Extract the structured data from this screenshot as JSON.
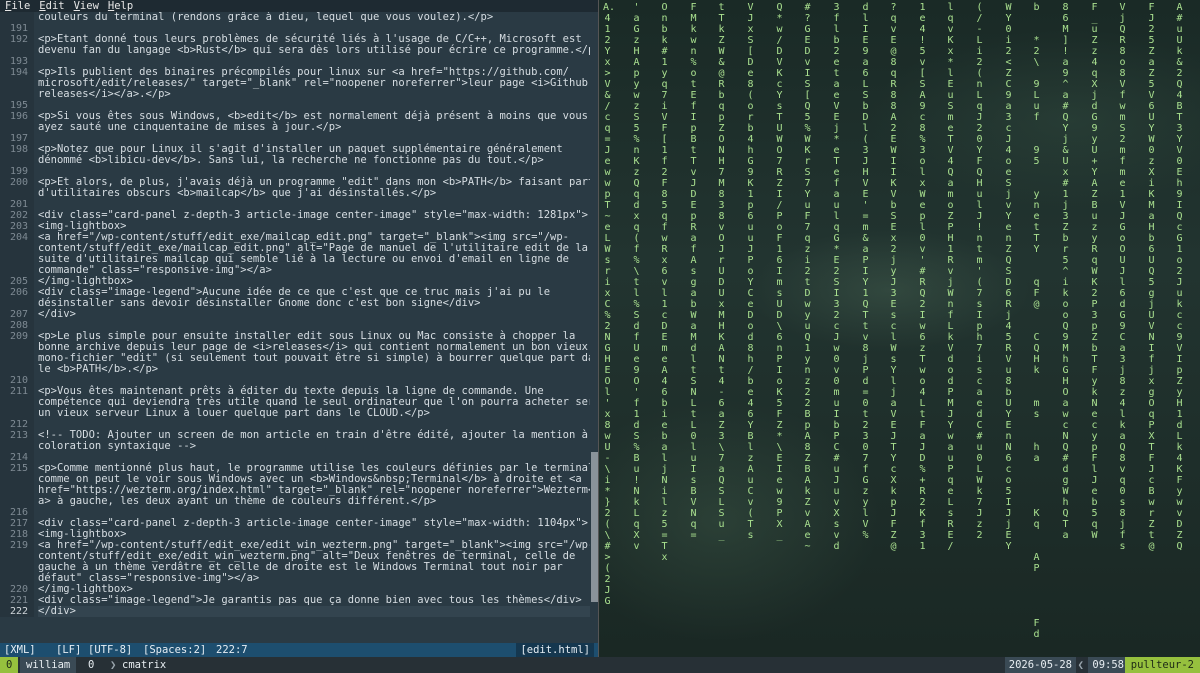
{
  "menu": [
    "File",
    "Edit",
    "View",
    "Help"
  ],
  "editor": {
    "lines": [
      {
        "n": "",
        "t": "couleurs du terminal (rendons grâce à dieu, lequel que vous voulez).</p>"
      },
      {
        "n": "191",
        "t": ""
      },
      {
        "n": "192",
        "t": "<p>Etant donné tous leurs problèmes de sécurité liés à l'usage de C/C++, Microsoft est"
      },
      {
        "n": "",
        "t": "devenu fan du langage <b>Rust</b> qui sera dès lors utilisé pour écrire ce programme.</p>"
      },
      {
        "n": "193",
        "t": ""
      },
      {
        "n": "194",
        "t": "<p>Ils publient des binaires précompilés pour linux sur <a href=\"https://github.com/"
      },
      {
        "n": "",
        "t": "microsoft/edit/releases/\" target=\"_blank\" rel=\"noopener noreferrer\">leur page <i>Github"
      },
      {
        "n": "",
        "t": "releases</i></a>.</p>"
      },
      {
        "n": "195",
        "t": ""
      },
      {
        "n": "196",
        "t": "<p>Si vous êtes sous Windows, <b>edit</b> est normalement déjà présent à moins que vous"
      },
      {
        "n": "",
        "t": "ayez sauté une cinquentaine de mises à jour.</p>"
      },
      {
        "n": "197",
        "t": ""
      },
      {
        "n": "198",
        "t": "<p>Notez que pour Linux il s'agit d'installer un paquet supplémentaire généralement"
      },
      {
        "n": "",
        "t": "dénommé <b>libicu-dev</b>. Sans lui, la recherche ne fonctionne pas du tout.</p>"
      },
      {
        "n": "199",
        "t": ""
      },
      {
        "n": "200",
        "t": "<p>Et alors, de plus, j'avais déjà un programme \"edit\" dans mon <b>PATH</b> faisant partie"
      },
      {
        "n": "",
        "t": "d'utilitaires obscurs <b>mailcap</b> que j'ai désinstallés.</p>"
      },
      {
        "n": "201",
        "t": ""
      },
      {
        "n": "202",
        "t": "<div class=\"card-panel z-depth-3 article-image center-image\" style=\"max-width: 1281px\">"
      },
      {
        "n": "203",
        "t": "<img-lightbox>"
      },
      {
        "n": "204",
        "t": "<a href=\"/wp-content/stuff/edit_exe/mailcap_edit.png\" target=\"_blank\"><img src=\"/wp-"
      },
      {
        "n": "",
        "t": "content/stuff/edit_exe/mailcap_edit.png\" alt=\"Page de manuel de l'utilitaire edit de la"
      },
      {
        "n": "",
        "t": "suite d'utilitaires mailcap qui semble lié à la lecture ou envoi d'email en ligne de"
      },
      {
        "n": "",
        "t": "commande\" class=\"responsive-img\"></a>"
      },
      {
        "n": "205",
        "t": "</img-lightbox>"
      },
      {
        "n": "206",
        "t": "<div class=\"image-legend\">Aucune idée de ce que c'est que ce truc mais j'ai pu le"
      },
      {
        "n": "",
        "t": "désinstaller sans devoir désinstaller Gnome donc c'est bon signe</div>"
      },
      {
        "n": "207",
        "t": "</div>"
      },
      {
        "n": "208",
        "t": ""
      },
      {
        "n": "209",
        "t": "<p>Le plus simple pour ensuite installer edit sous Linux ou Mac consiste à chopper la"
      },
      {
        "n": "",
        "t": "bonne archive depuis leur page de <i>releases</i> qui contient normalement un bon vieux"
      },
      {
        "n": "",
        "t": "mono-fichier \"edit\" (si seulement tout pouvait être si simple) à bourrer quelque part dans"
      },
      {
        "n": "",
        "t": "le <b>PATH</b>.</p>"
      },
      {
        "n": "210",
        "t": ""
      },
      {
        "n": "211",
        "t": "<p>Vous êtes maintenant prêts à éditer du texte depuis la ligne de commande. Une"
      },
      {
        "n": "",
        "t": "compétence qui deviendra très utile quand le seul ordinateur que l'on pourra acheter sera"
      },
      {
        "n": "",
        "t": "un vieux serveur Linux à louer quelque part dans le CLOUD.</p>"
      },
      {
        "n": "212",
        "t": ""
      },
      {
        "n": "213",
        "t": "<!-- TODO: Ajouter un screen de mon article en train d'être édité, ajouter la mention à la"
      },
      {
        "n": "",
        "t": "coloration syntaxique -->"
      },
      {
        "n": "214",
        "t": ""
      },
      {
        "n": "215",
        "t": "<p>Comme mentionné plus haut, le programme utilise les couleurs définies par le terminal,"
      },
      {
        "n": "",
        "t": "comme on peut le voir sous Windows avec un <b>Windows&nbsp;Terminal</b> à droite et <a"
      },
      {
        "n": "",
        "t": "href=\"https://wezterm.org/index.html\" target=\"_blank\" rel=\"noopener noreferrer\">Wezterm</"
      },
      {
        "n": "",
        "t": "a> à gauche, les deux ayant un thème de couleurs différent.</p>"
      },
      {
        "n": "216",
        "t": ""
      },
      {
        "n": "217",
        "t": "<div class=\"card-panel z-depth-3 article-image center-image\" style=\"max-width: 1104px\">"
      },
      {
        "n": "218",
        "t": "<img-lightbox>"
      },
      {
        "n": "219",
        "t": "<a href=\"/wp-content/stuff/edit_exe/edit_win_wezterm.png\" target=\"_blank\"><img src=\"/wp-"
      },
      {
        "n": "",
        "t": "content/stuff/edit_exe/edit_win_wezterm.png\" alt=\"Deux fenêtres de terminal, celle de"
      },
      {
        "n": "",
        "t": "gauche à un thème verdâtre et celle de droite est le Windows Terminal tout noir par"
      },
      {
        "n": "",
        "t": "défaut\" class=\"responsive-img\"></a>"
      },
      {
        "n": "220",
        "t": "</img-lightbox>"
      },
      {
        "n": "221",
        "t": "<div class=\"image-legend\">Je garantis pas que ça donne bien avec tous les thèmes</div>"
      },
      {
        "n": "222",
        "t": "</div>",
        "current": true
      }
    ],
    "status": {
      "lang": "[XML]",
      "eol": "[LF]",
      "enc": "[UTF-8]",
      "indent": "[Spaces:2]",
      "pos": "222:7",
      "file": "[edit.html]"
    }
  },
  "matrix_columns": [
    "A.\"4\"1\"2\"Y\"x\">\"V\"&\"/\"c\"q\"=\"J\"e\"w\"w\"p\"T\"~\"e\"L\"W\"s\"r\"i\"x\"C\"%\"2\"N\"G\"H\"E\"O\"l\"'\"x\"8\"w\"U\"-\"\\\"i\"*\"}\"2\"(\"\\\"#\">\"(\"2\"J\"G",
    "'\"a\"G\"z\"H\"A\"p\"y\"w\"z\"S\"5\"%\"n\"K\"z\"Q\"q\"d\"x\"q\"(\"f\"%\"\\\"t\"l\"%\"S\"d\"f\"U\"e\"9\"O\"'\"f\"1\"d\"S\"%\"B\"u\"!\"N\"k\"L\"q\"X\"v",
    "O\"n\"b\"k\"#\"1\"y\"q\"7\"i\"V\"F\"[\"1\"f\"2\"F\"8\"5\"q\"f\"w\"R\"x\"6\"v\"l\"1\"c\"D\"E\"m\"e\"A\"4\"6\"b\"i\"e\"b\"a\"l\"j\"N\"i\"l\"z\"5\"=\"T\"x",
    "F\"M\"k\"w\"n\"%\"o\"t\"E\"f\"I\"p\"B\"t\"T\"v\"J\"D\"E\"p\"R\"a\"f\"A\"s\"g\"a\"b\"W\"a\"M\"d\"l\"t\"S\"N\"L\"t\"L\"0\"l\"u\"I\"s\"B\"V\"N\"q\"=",
    "t\"T\"k\"Z\"W\"&\"@\"R\"b\"q\"p\"Z\"O\"N\"H\"7\"M\"8\"3\"8\"v\"O\"J\"r\"U\"D\"U\"x\"M\"H\"K\"A\"N\"t\"4\"-\"6\"a\"Z\"3\"\\\"7\"a\"Q\"S\"L\"S\"u\"_",
    "V\"J\"x\"S\"[\"D\"e\"8\"(\"o\"r\"b\"4\"h\"G\"9\"K\"1\"p\"6\"u\"u\"J\"P\"o\"Y\"C\"e\"D\"o\"d\"8\"h\"/\"b\"e\"4\"6\"Y\"B\"l\"z\"A\"u\"C\"v\"(\"T\"s",
    "Q\"*\"w\"/\"D\"V\"K\"c\"Y\"s\"T\"U\"W\"O\"7\"R\"Z\"I\"/\"P\"o\"F\"1\"6\"I\"m\"s\"U\"D\"\\\"6\"n\"P\"I\"o\"K\"5\"F\"Z\"*\"\\\"E\"I\"e\"w\"9\"P\"X\"_",
    "#\"?\"G\"E\"D\"v\"I\"S\"[\"Q\"5\"%\"W\"K\"r\"S\"7\"Y\"u\"F\"7\"q\"z\"i\"2\"t\"D\"w\"y\"u\"Q\"1\"y\"n\"z\"2\"2\"B\"p\"A\"8\"Z\"B\"A\"k\"Z\"v\"A\"e\"~",
    "3\"f\"l\"b\"2\"e\"t\"a\"e\"V\"E\"j\"*\"e\"T\"e\"f\"a\"u\"l\"q\"G\"*\"E\"2\"S\"I\"3\"2\"c\"J\"w\"0\"v\"0\"m\"u\"I\"b\"P\"C\"#\"u\"J\"u\"v\"X\"s\"v\"d",
    "d\"l\"I\"E\"9\"a\"6\"L\"S\"b\"D\"l\"(\"3\"J\"H\"V\"E\"'\"=\"m\"&\"a\"P\"I\"Y\"1\"Q\"T\"t\"v\"8\"j\"P\"d\"=\"0\"t\"2\"3\"0\"7\"f\"G\"z\"y\"l\"V\"%",
    "?\"q\"v\"E\"@\"8\"q\"R\"8\"8\"A\"2\"E\"W\"I\"I\"K\"V\"b\"S\"E\"x\"2\"j\"y\"J\"3\"E\"s\"c\"l\"W\"s\"Y\"l\"j\"a\"V\"E\"J\"T\"Y\"c\"X\"k\"p\"J\"F\"Z\"@",
    "1\"e\"4\"!\"5\"v\"[\"S\"A\"9\"c\"8\"%\"3\"o\"l\"x\"W\"e\"p\"l\"0\"v\"'\"#\"R\"Q\"2\"I\"w\"6\"z\"T\"w\"o\"4\"L\"t\"F\"a\"J\"D\"%\"+\"R\"2\"K\"f\"3\"1",
    "l\"q\"v\"K\"x\"*\"l\"E\"u\"S\"m\"e\"T\"V\"4\"Q\"a\"m\"o\"Z\"P\"H\"1\"R\"v\"j\"W\"n\"f\"L\"k\"V\"d\"o\"d\"P\"M\"J\"Y\"w\"a\"u\"P\"q\"e\"L\"s\"R\"E\"/",
    "(\"/\"-\"L\"i\"2\"(\"n\"L\"q\"J\"2\"0\"Y\"F\"Q\"H\"u\"l\"J\"!\"n\"t\"m\"'\"(\"7\"s\"I\"p\"h\"7\"i\"s\"c\"a\"e\"d\"C\"#\"u\"0\"L\"W\"k\"7\"J\"z\"2",
    "W\"Y\"0\"i\"2\"<\"Z\"C\"9\"a\"3\"c\"J\"4\"o\"e\"S\"j\"v\"Y\"e\"n\"Z\"Q\"S\"D\"6\"R\"j\"4\"5\"R\"V\"u\"8\"b\"U\"Y\"E\"n\"N\"6\"c\"o\"5\"I\"J\"j\"E\"Y",
    "b\"\"\"*\"2\"\\\"\"9\"L\"u\"f\"\"\"9\"5\"\"\"y\"n\"e\"t\"T\"Y\"\"\"q\"F\"@\"\"\"C\"Q\"H\"k\"\"\"m\"s\"\"\"h\"a\"\"\"\"\"K\"q\"\"\"A\"P\"\"\"\"\"F\"d",
    "8\"6\"M\"]\"!\"a\"9\"^\"a\"#\"Q\"Y\"j\"&\"U\"x\"#\"1\"j\"3\"Z\"b\"r\"5\"^\"i\"k\"o\"o\"Q\"9\"M\"h\"G\"H\"O\"a\"w\"c\"N\"Q\"#\"d\"g\"W\"h\"Q\"T\"a",
    "F\"_\"u\"Z\"z\"4\"q\"X\"j\"d\"G\"9\"y\"U\"+\"Y\"A\"Z\"B\"u\"z\"y\"R\"q\"W\"K\"2\"P\"3\"p\"Z\"b\"T\"F\"y\"k\"N\"e\"c\"y\"p\"F\"l\"J\"e\"b\"5\"q\"W",
    "V\"j\"Q\"R\"8\"o\"8\"V\"f\"w\"m\"S\"2\"m\"f\"m\"e\"1\"V\"J\"G\"o\"O\"U\"J\"l\"6\"d\"G\"9\"C\"a\"3\"j\"8\"z\"4\"l\"k\"a\"Q\"8\"v\"q\"0\"s\"8\"j\"f\"s",
    "F\"J\"2\"5\"Z\"a\"Z\"5\"V\"6\"U\"Y\"W\"0\"z\"X\"i\"K\"M\"a\"H\"b\"6\"U\"Q\"5\"g\"j\"U\"V\"N\"I\"f\"j\"x\"g\"O\"q\"P\"X\"T\"F\"J\"c\"B\"w\"r\"Z\"t\"@",
    "A\"#\"u\"U\"k\"&\"2\"Q\"4\"B\"T\"3\"Y\"V\"0\"E\"h\"9\"I\"Q\"c\"G\"1\"o\"2\"J\"u\"k\"c\"c\"9\"V\"I\"p\"Z\"y\"H\"1\"d\"L\"k\"4\"K\"F\"y\"w\"v\"D\"Z\"Q"
  ],
  "tmux": {
    "win_index": "0",
    "user": "william",
    "session_index": "0",
    "session_name": "cmatrix",
    "date": "2026-05-28",
    "time": "09:58",
    "host": "pullteur-2"
  },
  "colors": {
    "editor_bg": "#2a3a44",
    "status_bg": "#1d4e6f",
    "matrix_fg": "#a9e08f",
    "tmux_accent": "#96c03e"
  }
}
